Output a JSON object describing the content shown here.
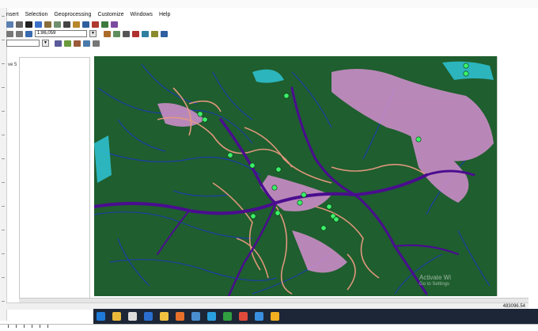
{
  "menu": [
    "nsert",
    "Selection",
    "Geoprocessing",
    "Customize",
    "Windows",
    "Help"
  ],
  "toolbar": {
    "scale_value": "1:86,059",
    "buttons": [
      {
        "icon": "add-data-icon",
        "color": "#5a7fb0"
      },
      {
        "icon": "pan-icon",
        "color": "#666666"
      },
      {
        "icon": "pointer-icon",
        "color": "#222222"
      },
      {
        "icon": "globe-icon",
        "color": "#3b70c9"
      },
      {
        "icon": "edit-icon",
        "color": "#8a6f3b"
      },
      {
        "icon": "table-icon",
        "color": "#6f8f6f"
      },
      {
        "icon": "binoculars-icon",
        "color": "#444444"
      },
      {
        "icon": "catalog-icon",
        "color": "#b8862b"
      },
      {
        "icon": "search-icon",
        "color": "#2f5f9f"
      },
      {
        "icon": "toolbox-icon",
        "color": "#b03a2e"
      },
      {
        "icon": "python-icon",
        "color": "#3c7a3c"
      },
      {
        "icon": "model-icon",
        "color": "#7a4aa0"
      }
    ],
    "row2_buttons": [
      {
        "icon": "undo-icon",
        "color": "#777777"
      },
      {
        "icon": "redo-icon",
        "color": "#777777"
      },
      {
        "icon": "zoom-icon",
        "color": "#3a6ab0"
      },
      {
        "icon": "layer-icon",
        "color": "#aa6a2a"
      },
      {
        "icon": "layout-icon",
        "color": "#5f8f5f"
      },
      {
        "icon": "print-icon",
        "color": "#555555"
      },
      {
        "icon": "refresh-icon",
        "color": "#b03030"
      },
      {
        "icon": "export-icon",
        "color": "#2f7fa0"
      },
      {
        "icon": "measure-icon",
        "color": "#8a8a2a"
      },
      {
        "icon": "identify-icon",
        "color": "#2f5fa0"
      }
    ],
    "row3_buttons": [
      {
        "icon": "editor-icon",
        "color": "#5a5a9a"
      },
      {
        "icon": "sketch-icon",
        "color": "#6a9a3a"
      },
      {
        "icon": "snap-icon",
        "color": "#9a5a3a"
      },
      {
        "icon": "attribute-icon",
        "color": "#4a7aaa"
      },
      {
        "icon": "vertex-icon",
        "color": "#777777"
      }
    ]
  },
  "toc": {
    "label": "ve 5"
  },
  "map": {
    "colors": {
      "forest": "#1f5e2e",
      "river_main": "#4a0d8f",
      "river_minor": "#1a3bb0",
      "urban_pink": "#d48fd0",
      "roads_salmon": "#e89a80",
      "water_cyan": "#2fc4d6",
      "points_green": "#3cf06a"
    }
  },
  "status": {
    "coordinates": "483096.54"
  },
  "watermark": {
    "title": "Activate Wi",
    "subtitle": "Go to Settings"
  },
  "taskbar": [
    {
      "icon": "edge-icon",
      "color": "#1f7ad8"
    },
    {
      "icon": "file-explorer-icon",
      "color": "#e8b83a"
    },
    {
      "icon": "store-icon",
      "color": "#dcdcdc"
    },
    {
      "icon": "mail-icon",
      "color": "#2a6fd0"
    },
    {
      "icon": "files-icon",
      "color": "#f0c040"
    },
    {
      "icon": "firefox-icon",
      "color": "#e8702a"
    },
    {
      "icon": "arcmap-icon",
      "color": "#4a8fd0"
    },
    {
      "icon": "skype-icon",
      "color": "#2aa0e0"
    },
    {
      "icon": "app-green-icon",
      "color": "#30a040"
    },
    {
      "icon": "chrome-icon",
      "color": "#e04a3a"
    },
    {
      "icon": "app-blue-icon",
      "color": "#3a8fe0"
    },
    {
      "icon": "chrome-alt-icon",
      "color": "#f0b020"
    }
  ]
}
